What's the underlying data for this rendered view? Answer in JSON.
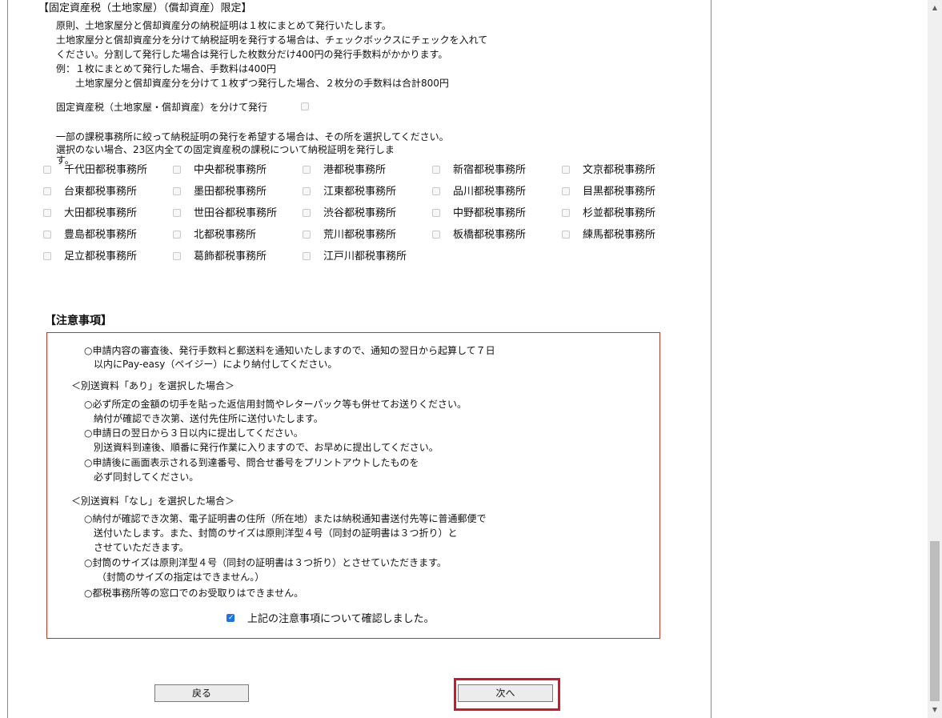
{
  "section_heading": "【固定資産税（土地家屋）（償却資産）限定】",
  "info_lines": [
    "原則、土地家屋分と償却資産分の納税証明は１枚にまとめて発行いたします。",
    "土地家屋分と償却資産分を分けて納税証明を発行する場合は、チェックボックスにチェックを入れて",
    "ください。分割して発行した場合は発行した枚数分だけ400円の発行手数料がかかります。",
    "例：１枚にまとめて発行した場合、手数料は400円",
    "土地家屋分と償却資産分を分けて１枚ずつ発行した場合、２枚分の手数料は合計800円"
  ],
  "split_label": "固定資産税（土地家屋・償却資産）を分けて発行",
  "office_lines": [
    "一部の課税事務所に絞って納税証明の発行を希望する場合は、その所を選択してください。",
    "選択のない場合、23区内全ての固定資産税の課税について納税証明を発行しま",
    "す。"
  ],
  "offices": [
    [
      "千代田都税事務所",
      "中央都税事務所",
      "港都税事務所",
      "新宿都税事務所",
      "文京都税事務所"
    ],
    [
      "台東都税事務所",
      "墨田都税事務所",
      "江東都税事務所",
      "品川都税事務所",
      "目黒都税事務所"
    ],
    [
      "大田都税事務所",
      "世田谷都税事務所",
      "渋谷都税事務所",
      "中野都税事務所",
      "杉並都税事務所"
    ],
    [
      "豊島都税事務所",
      "北都税事務所",
      "荒川都税事務所",
      "板橋都税事務所",
      "練馬都税事務所"
    ],
    [
      "足立都税事務所",
      "葛飾都税事務所",
      "江戸川都税事務所"
    ]
  ],
  "notice_heading": "【注意事項】",
  "notice": {
    "p1": [
      "○申請内容の審査後、発行手数料と郵送料を通知いたしますので、通知の翌日から起算して７日",
      "以内にPay-easy（ペイジー）により納付してください。"
    ],
    "ari_heading": "＜別送資料「あり」を選択した場合＞",
    "ari": [
      "○必ず所定の金額の切手を貼った返信用封筒やレターパック等も併せてお送りください。",
      "納付が確認でき次第、送付先住所に送付いたします。",
      "○申請日の翌日から３日以内に提出してください。",
      "別送資料到達後、順番に発行作業に入りますので、お早めに提出してください。",
      "○申請後に画面表示される到達番号、問合せ番号をプリントアウトしたものを",
      "必ず同封してください。"
    ],
    "nashi_heading": "＜別送資料「なし」を選択した場合＞",
    "nashi": [
      "○納付が確認でき次第、電子証明書の住所（所在地）または納税通知書送付先等に普通郵便で",
      "送付いたします。また、封筒のサイズは原則洋型４号（同封の証明書は３つ折り）と",
      "させていただきます。",
      "○封筒のサイズは原則洋型４号（同封の証明書は３つ折り）とさせていただきます。",
      "（封筒のサイズの指定はできません。）",
      "○都税事務所等の窓口でのお受取りはできません。"
    ],
    "confirm_label": "上記の注意事項について確認しました。"
  },
  "buttons": {
    "back": "戻る",
    "next": "次へ"
  }
}
